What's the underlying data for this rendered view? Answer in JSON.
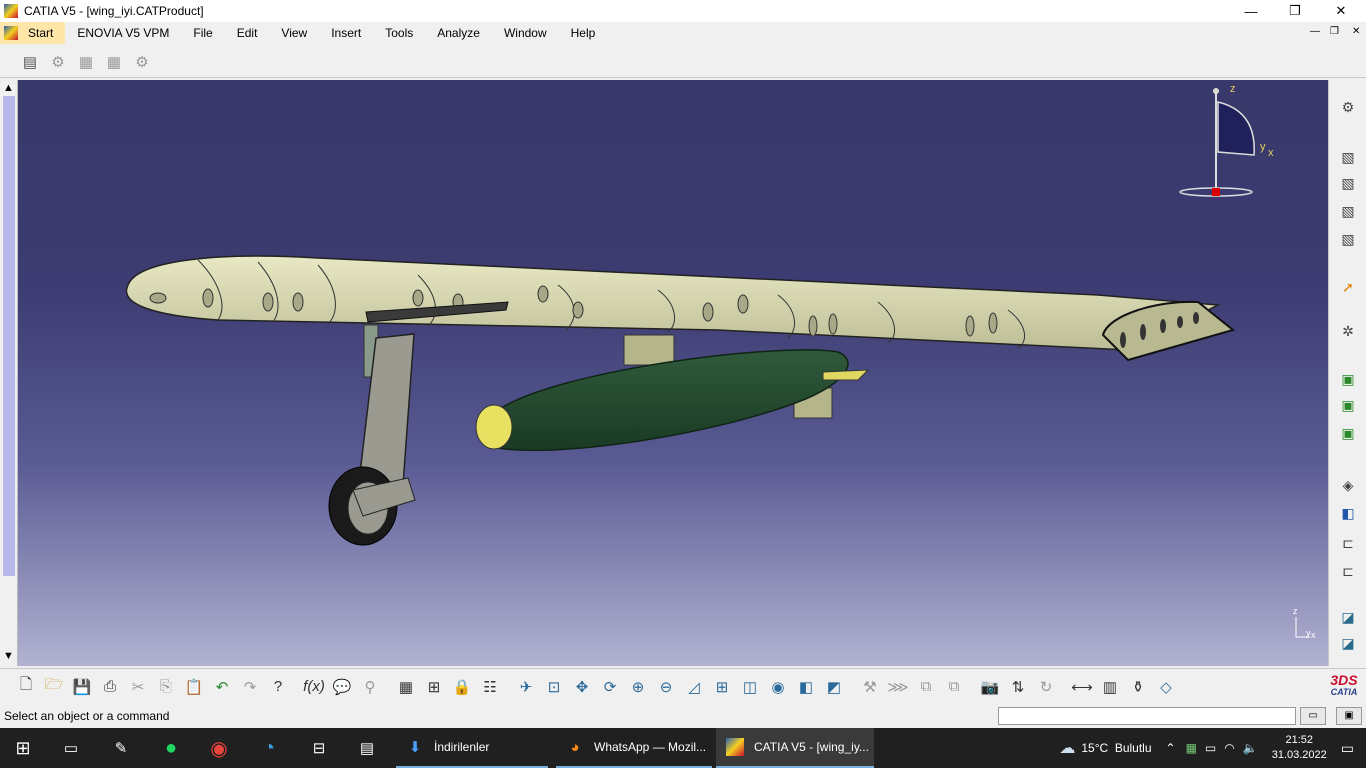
{
  "window": {
    "title": "CATIA V5 - [wing_iyi.CATProduct]",
    "minimize": "—",
    "maximize": "❐",
    "close": "✕"
  },
  "menu": {
    "items": [
      "Start",
      "ENOVIA V5 VPM",
      "File",
      "Edit",
      "View",
      "Insert",
      "Tools",
      "Analyze",
      "Window",
      "Help"
    ]
  },
  "compass": {
    "z": "z",
    "y": "y",
    "x": "x"
  },
  "axis_triad": {
    "z": "z",
    "y": "y",
    "x": "x"
  },
  "catia_logo": {
    "mark": "3DS",
    "text": "CATIA"
  },
  "status": {
    "message": "Select an object or a command",
    "command_input_value": ""
  },
  "taskbar": {
    "downloads_label": "İndirilenler",
    "firefox_label": "WhatsApp — Mozil...",
    "catia_label": "CATIA V5 - [wing_iy...",
    "weather": "15°C  Bulutlu",
    "time": "21:52",
    "date": "31.03.2022"
  }
}
